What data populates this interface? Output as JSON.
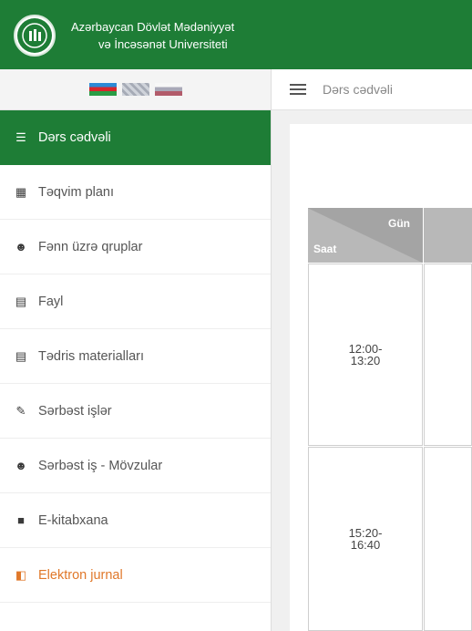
{
  "header": {
    "university_line1": "Azərbaycan Dövlət Mədəniyyət",
    "university_line2": "və İncəsənət Universiteti"
  },
  "language_flags": [
    "az",
    "en",
    "ru"
  ],
  "breadcrumb": {
    "title": "Dərs cədvəli"
  },
  "sidebar": {
    "items": [
      {
        "label": "Dərs cədvəli",
        "icon": "table-icon",
        "active": true
      },
      {
        "label": "Təqvim planı",
        "icon": "calendar-icon"
      },
      {
        "label": "Fənn üzrə qruplar",
        "icon": "users-icon"
      },
      {
        "label": "Fayl",
        "icon": "file-icon"
      },
      {
        "label": "Tədris materialları",
        "icon": "file-icon"
      },
      {
        "label": "Sərbəst işlər",
        "icon": "pencil-icon"
      },
      {
        "label": "Sərbəst iş - Mövzular",
        "icon": "users-icon"
      },
      {
        "label": "E-kitabxana",
        "icon": "book-icon"
      },
      {
        "label": "Elektron jurnal",
        "icon": "journal-icon",
        "color": "#e0782a"
      }
    ]
  },
  "schedule": {
    "header_day": "Gün",
    "header_hour": "Saat",
    "rows": [
      {
        "time": "12:00-13:20"
      },
      {
        "time": "15:20-16:40"
      }
    ]
  },
  "colors": {
    "brand_green": "#1e7d36",
    "accent_orange": "#e0782a"
  }
}
